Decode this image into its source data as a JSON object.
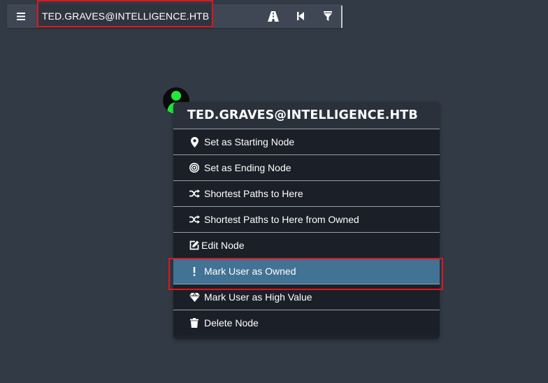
{
  "search": {
    "value": "TED.GRAVES@INTELLIGENCE.HTB",
    "menu_icon": "hamburger-icon",
    "tools": [
      {
        "name": "pathfinding-icon"
      },
      {
        "name": "back-icon"
      },
      {
        "name": "filter-icon"
      }
    ]
  },
  "node": {
    "icon": "user-icon",
    "colors": {
      "fill": "#000000",
      "glyph": "#22e83a"
    }
  },
  "context_menu": {
    "title": "TED.GRAVES@INTELLIGENCE.HTB",
    "items": [
      {
        "label": "Set as Starting Node",
        "icon": "map-marker-icon"
      },
      {
        "label": "Set as Ending Node",
        "icon": "bullseye-icon"
      },
      {
        "label": "Shortest Paths to Here",
        "icon": "random-icon"
      },
      {
        "label": "Shortest Paths to Here from Owned",
        "icon": "random-icon"
      },
      {
        "label": "Edit Node",
        "icon": "edit-icon"
      },
      {
        "label": "Mark User as Owned",
        "icon": "exclamation-icon",
        "active": true
      },
      {
        "label": "Mark User as High Value",
        "icon": "diamond-icon"
      },
      {
        "label": "Delete Node",
        "icon": "trash-icon"
      }
    ]
  },
  "colors": {
    "background": "#313a45",
    "active_item": "#427294",
    "highlight_border": "#e0171a"
  }
}
